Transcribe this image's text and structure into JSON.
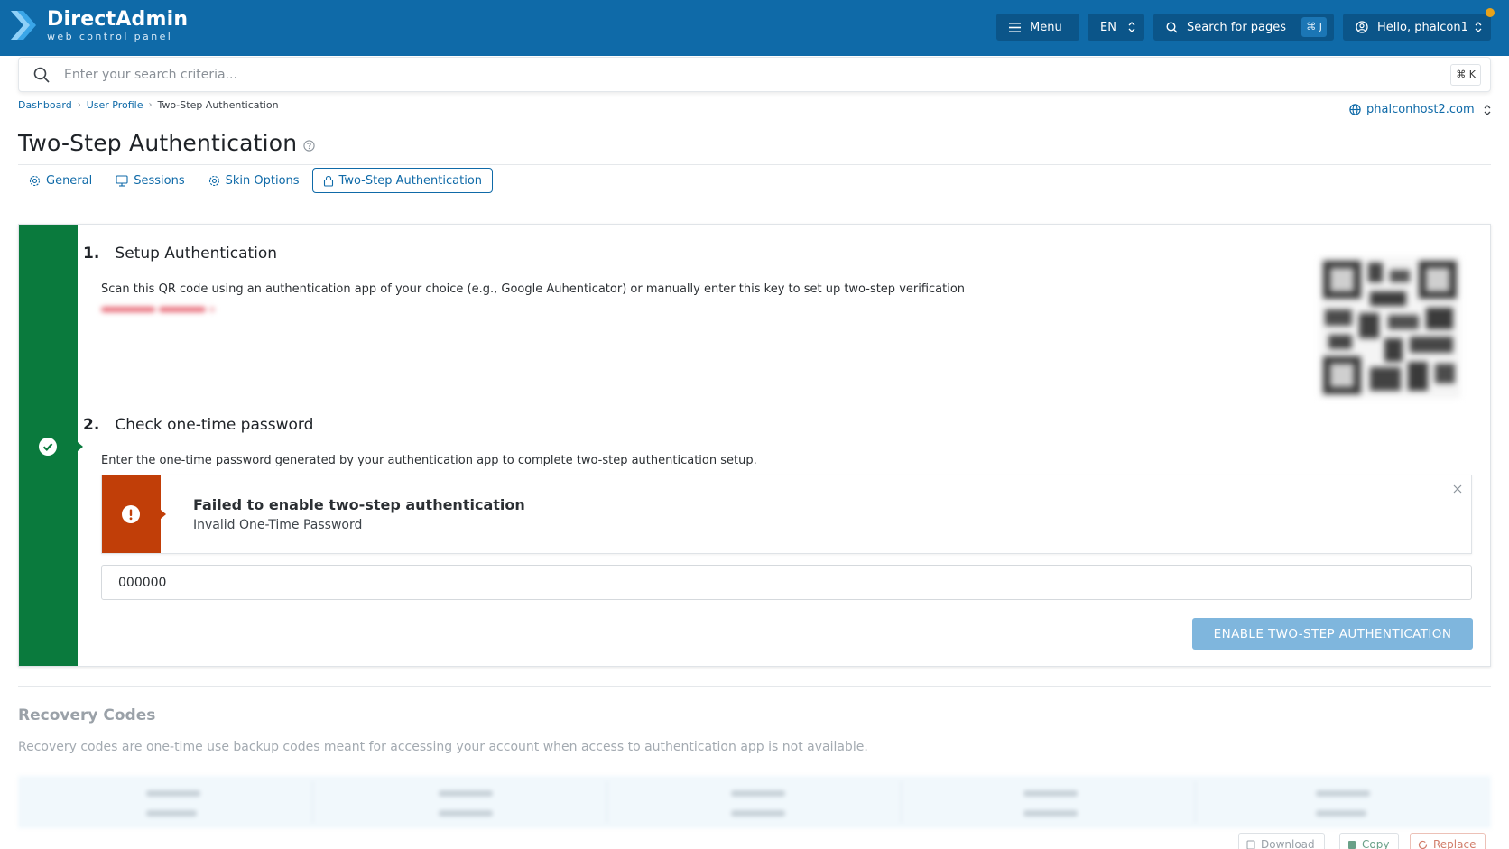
{
  "header": {
    "brand": "DirectAdmin",
    "brand_sub": "web control panel",
    "menu_label": "Menu",
    "language": "EN",
    "search_label": "Search for pages",
    "search_shortcut": "⌘ J",
    "user_label": "Hello, phalcon1",
    "notification_color": "#e8a21a",
    "bar_color": "#0f6aa8"
  },
  "global_search": {
    "placeholder": "Enter your search criteria...",
    "shortcut": "⌘ K"
  },
  "breadcrumb": {
    "items": [
      "Dashboard",
      "User Profile",
      "Two-Step Authentication"
    ]
  },
  "domain_selector": {
    "value": "phalconhost2.com"
  },
  "page": {
    "title": "Two-Step Authentication"
  },
  "tabs": [
    {
      "label": "General",
      "icon": "gear-icon",
      "active": false
    },
    {
      "label": "Sessions",
      "icon": "monitor-icon",
      "active": false
    },
    {
      "label": "Skin Options",
      "icon": "gear-icon",
      "active": false
    },
    {
      "label": "Two-Step Authentication",
      "icon": "lock-icon",
      "active": true
    }
  ],
  "wizard": {
    "strip_color": "#0a7a3d",
    "step1": {
      "number": "1.",
      "title": "Setup Authentication",
      "text": "Scan this QR code using an authentication app of your choice (e.g., Google Auhenticator) or manually enter this key to set up two-step verification"
    },
    "step2": {
      "number": "2.",
      "title": "Check one-time password",
      "text": "Enter the one-time password generated by your authentication app to complete two-step authentication setup.",
      "otp_value": "000000"
    },
    "alert": {
      "title": "Failed to enable two-step authentication",
      "message": "Invalid One-Time Password",
      "color": "#c13e08"
    },
    "submit_label": "ENABLE TWO-STEP AUTHENTICATION"
  },
  "recovery": {
    "title": "Recovery Codes",
    "description": "Recovery codes are one-time use backup codes meant for accessing your account when access to authentication app is not available.",
    "buttons": {
      "download": "Download",
      "copy": "Copy",
      "replace": "Replace"
    }
  }
}
